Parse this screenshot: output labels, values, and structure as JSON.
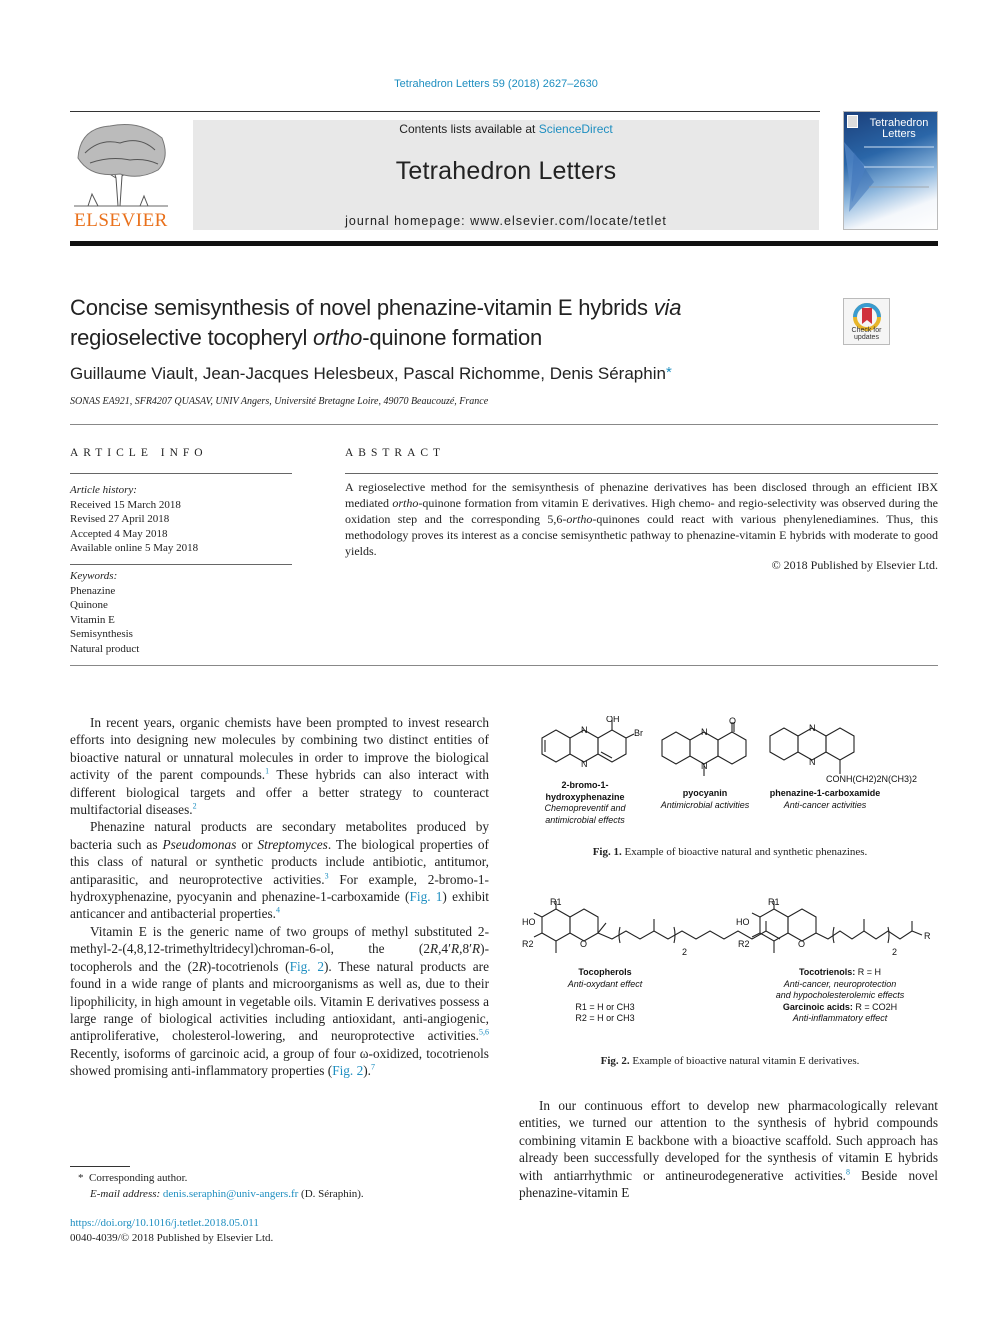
{
  "header": {
    "journal_ref": "Tetrahedron Letters 59 (2018) 2627–2630",
    "contents_prefix": "Contents lists available at ",
    "contents_link": "ScienceDirect",
    "journal_name": "Tetrahedron Letters",
    "homepage": "journal homepage: www.elsevier.com/locate/tetlet",
    "publisher_logo": "ELSEVIER",
    "cover_title_1": "Tetrahedron",
    "cover_title_2": "Letters",
    "brand_color": "#e9711c",
    "link_color": "#1e8ec0"
  },
  "article": {
    "title_part1": "Concise semisynthesis of novel phenazine-vitamin E hybrids ",
    "title_via": "via",
    "title_part2": "regioselective tocopheryl ",
    "title_ortho": "ortho",
    "title_part3": "-quinone formation",
    "crossmark_label_1": "Check for",
    "crossmark_label_2": "updates",
    "authors": "Guillaume Viault, Jean-Jacques Helesbeux, Pascal Richomme, Denis Séraphin",
    "corresponding_mark": "*",
    "affiliation": "SONAS EA921, SFR4207 QUASAV, UNIV Angers, Université Bretagne Loire, 49070 Beaucouzé, France"
  },
  "article_info": {
    "heading": "ARTICLE INFO",
    "history_label": "Article history:",
    "history": [
      "Received 15 March 2018",
      "Revised 27 April 2018",
      "Accepted 4 May 2018",
      "Available online 5 May 2018"
    ],
    "keywords_label": "Keywords:",
    "keywords": [
      "Phenazine",
      "Quinone",
      "Vitamin E",
      "Semisynthesis",
      "Natural product"
    ]
  },
  "abstract": {
    "heading": "ABSTRACT",
    "t1": "A regioselective method for the semisynthesis of phenazine derivatives has been disclosed through an efficient IBX mediated ",
    "i1": "ortho",
    "t2": "-quinone formation from vitamin E derivatives. High chemo- and regio-selectivity was observed during the oxidation step and the corresponding 5,6-",
    "i2": "ortho",
    "t3": "-quinones could react with various phenylenediamines. Thus, this methodology proves its interest as a concise semisynthetic pathway to phenazine-vitamin E hybrids with moderate to good yields.",
    "copyright": "© 2018 Published by Elsevier Ltd."
  },
  "body_left": {
    "p1_a": "In recent years, organic chemists have been prompted to invest research efforts into designing new molecules by combining two distinct entities of bioactive natural or unnatural molecules in order to improve the biological activity of the parent compounds.",
    "p1_ref1": "1",
    "p1_b": " These hybrids can also interact with different biological targets and offer a better strategy to counteract multifactorial diseases.",
    "p1_ref2": "2",
    "p2_a": "Phenazine natural products are secondary metabolites produced by bacteria such as ",
    "p2_i1": "Pseudomonas",
    "p2_b": " or ",
    "p2_i2": "Streptomyces",
    "p2_c": ". The biological properties of this class of natural or synthetic products include antibiotic, antitumor, antiparasitic, and neuroprotective activities.",
    "p2_ref3": "3",
    "p2_d": " For example, 2-bromo-1-hydroxyphenazine, pyocyanin and phenazine-1-carboxamide (",
    "p2_fig": "Fig. 1",
    "p2_e": ") exhibit anticancer and antibacterial properties.",
    "p2_ref4": "4",
    "p3_a": "Vitamin E is the generic name of two groups of methyl substituted 2-methyl-2-(4,8,12-trimethyltridecyl)chroman-6-ol, the (2",
    "p3_R1": "R",
    "p3_b": ",4′",
    "p3_R2": "R",
    "p3_c": ",8′",
    "p3_R3": "R",
    "p3_d": ")-tocopherols and the (2",
    "p3_R4": "R",
    "p3_e": ")-tocotrienols (",
    "p3_fig": "Fig. 2",
    "p3_f": "). These natural products are found in a wide range of plants and microorganisms as well as, due to their lipophilicity, in high amount in vegetable oils. Vitamin E derivatives possess a large range of biological activities including antioxidant, anti-angiogenic, antiproliferative, cholesterol-lowering, and neuroprotective activities.",
    "p3_ref56": "5,6",
    "p3_g": " Recently, isoforms of garcinoic acid, a group of four ω-oxidized, tocotrienols showed promising anti-inflammatory properties (",
    "p3_fig2": "Fig. 2",
    "p3_h": ").",
    "p3_ref7": "7"
  },
  "body_right": {
    "p1_a": "In our continuous effort to develop new pharmacologically relevant entities, we turned our attention to the synthesis of hybrid compounds combining vitamin E backbone with a bioactive scaffold. Such approach has already been successfully developed for the synthesis of vitamin E hybrids with antiarrhythmic or antineurodegenerative activities.",
    "p1_ref8": "8",
    "p1_b": " Beside novel phenazine-vitamin E"
  },
  "figure1": {
    "label": "Fig. 1.",
    "caption": " Example of bioactive natural and synthetic phenazines.",
    "compounds": [
      {
        "name": "2-bromo-1-hydroxyphenazine",
        "name_l1": "2-bromo-1-",
        "name_l2": "hydroxyphenazine",
        "activity_l1": "Chemopreventif and",
        "activity_l2": "antimicrobial effects",
        "atoms": [
          "OH",
          "Br",
          "N",
          "N"
        ]
      },
      {
        "name": "pyocyanin",
        "activity": "Antimicrobial activities",
        "atoms": [
          "O",
          "N",
          "N"
        ]
      },
      {
        "name": "phenazine-1-carboxamide",
        "activity": "Anti-cancer activities",
        "atoms": [
          "N",
          "N"
        ],
        "substituent": "CONH(CH2)2N(CH3)2"
      }
    ]
  },
  "figure2": {
    "label": "Fig. 2.",
    "caption": " Example of bioactive natural vitamin E derivatives.",
    "tocopherols": {
      "name": "Tocopherols",
      "activity": "Anti-oxydant effect",
      "r1": "R1 = H or CH3",
      "r2": "R2 = H or CH3",
      "repeat": "2"
    },
    "tocotrienols": {
      "name": "Tocotrienols:",
      "r": " R = H",
      "activity_l1": "Anti-cancer, neuroprotection",
      "activity_l2": "and hypocholesterolemic effects",
      "repeat": "2"
    },
    "garcinoic": {
      "name": "Garcinoic acids:",
      "r": " R = CO2H",
      "activity": "Anti-inflammatory effect"
    },
    "atoms": {
      "ho": "HO",
      "r1": "R1",
      "r2": "R2",
      "o": "O",
      "r": "R"
    }
  },
  "footnote": {
    "mark": "*",
    "corresponding": "Corresponding author.",
    "email_label": "E-mail address: ",
    "email": "denis.seraphin@univ-angers.fr",
    "email_suffix": " (D. Séraphin).",
    "doi": "https://doi.org/10.1016/j.tetlet.2018.05.011",
    "issn": "0040-4039/© 2018 Published by Elsevier Ltd."
  }
}
